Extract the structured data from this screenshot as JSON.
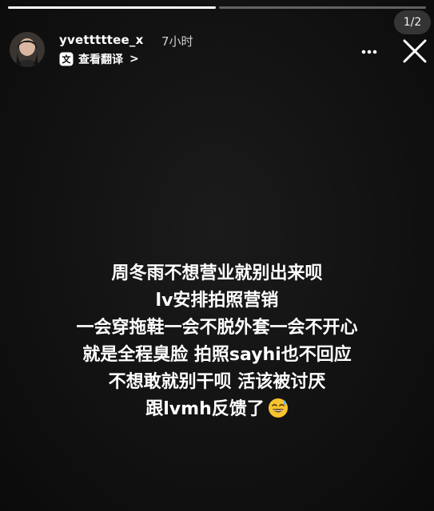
{
  "story": {
    "counter": "1/2",
    "progress": [
      1.0,
      0.0
    ],
    "header": {
      "username": "yvetttttee_x",
      "time": "7小时",
      "translate_label": "查看翻译",
      "translate_chevron": ">",
      "avatar_icon": "profile-avatar",
      "more_icon": "more-horizontal-icon",
      "close_icon": "close-icon"
    },
    "caption_lines": [
      "周冬雨不想营业就别出来呗",
      "lv安排拍照营销",
      "一会穿拖鞋一会不脱外套一会不开心",
      "就是全程臭脸 拍照sayhi也不回应",
      "不想敢就别干呗 活该被讨厌",
      "跟lvmh反馈了"
    ],
    "caption_emoji": "grinning-face-with-sweat-emoji",
    "colors": {
      "background": "#121212",
      "text": "#ffffff",
      "emoji": "#f7c42f"
    }
  }
}
